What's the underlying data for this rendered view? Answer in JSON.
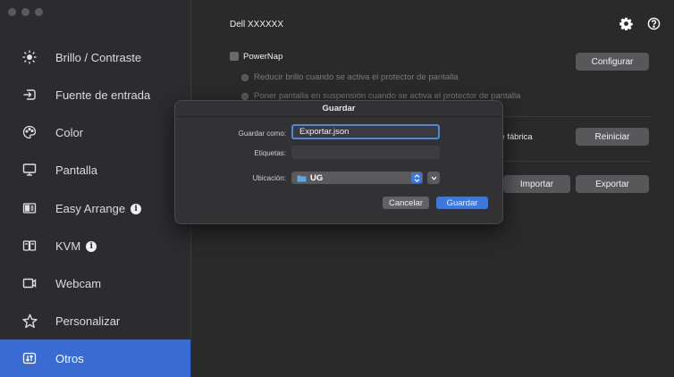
{
  "window": {
    "title": "Dell XXXXXX"
  },
  "header": {
    "settings_icon": "gear-icon",
    "help_icon": "question-circle-icon"
  },
  "sidebar": {
    "items": [
      {
        "label": "Brillo / Contraste",
        "icon": "brightness-icon",
        "active": false
      },
      {
        "label": "Fuente de entrada",
        "icon": "input-source-icon",
        "active": false
      },
      {
        "label": "Color",
        "icon": "color-palette-icon",
        "active": false
      },
      {
        "label": "Pantalla",
        "icon": "monitor-icon",
        "active": false
      },
      {
        "label": "Easy Arrange",
        "icon": "easy-arrange-icon",
        "active": false,
        "info": "i"
      },
      {
        "label": "KVM",
        "icon": "kvm-icon",
        "active": false,
        "info": "i"
      },
      {
        "label": "Webcam",
        "icon": "webcam-icon",
        "active": false
      },
      {
        "label": "Personalizar",
        "icon": "star-icon",
        "active": false
      },
      {
        "label": "Otros",
        "icon": "others-icon",
        "active": true
      }
    ]
  },
  "main": {
    "powernap": {
      "label": "PowerNap",
      "configure_button": "Configurar",
      "option_dim": "Reducir brillo cuando se activa el protector de pantalla",
      "option_sleep": "Poner pantalla en suspensión cuando se activa el protector de pantalla"
    },
    "factory": {
      "label_partial": "de fábrica",
      "reset_button": "Reiniciar"
    },
    "settings": {
      "import_button": "Importar",
      "export_button": "Exportar"
    }
  },
  "dialog": {
    "title": "Guardar",
    "save_as_label": "Guardar como:",
    "save_as_value": "Exportar.json",
    "tags_label": "Etiquetas:",
    "tags_value": "",
    "location_label": "Ubicación:",
    "location_value": "UG",
    "cancel_button": "Cancelar",
    "save_button": "Guardar"
  },
  "colors": {
    "accent": "#3a6bd1",
    "focus_ring": "#4f86e0",
    "folder": "#5aa8e8"
  }
}
